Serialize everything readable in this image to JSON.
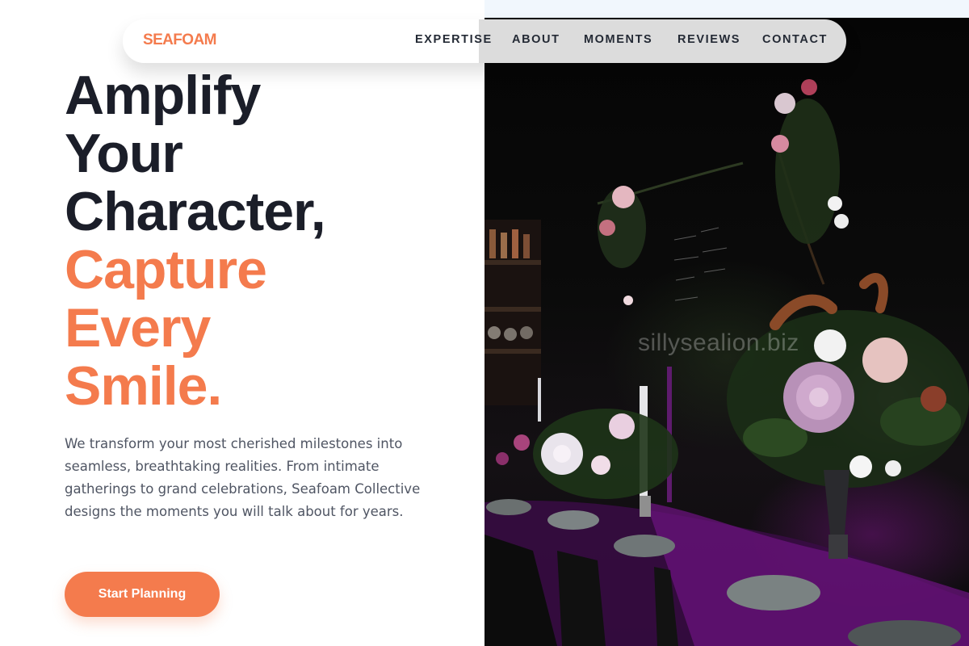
{
  "brand": {
    "name": "SEAFOAM",
    "color": "#f47b4d"
  },
  "nav": {
    "links": [
      "EXPERTISE",
      "ABOUT",
      "MOMENTS",
      "REVIEWS",
      "CONTACT"
    ]
  },
  "hero": {
    "headline_dark": [
      "Amplify",
      "Your",
      "Character,"
    ],
    "headline_accent": [
      "Capture",
      "Every",
      "Smile."
    ],
    "lead": "We transform your most cherished milestones into seamless, breathtaking realities. From intimate gatherings to grand celebrations, Seafoam Collective designs the moments you will talk about for years.",
    "cta_label": "Start Planning",
    "image_watermark": "sillysealion.biz"
  },
  "colors": {
    "accent": "#f47b4d",
    "heading": "#1b1e29",
    "body": "#4f5563"
  }
}
